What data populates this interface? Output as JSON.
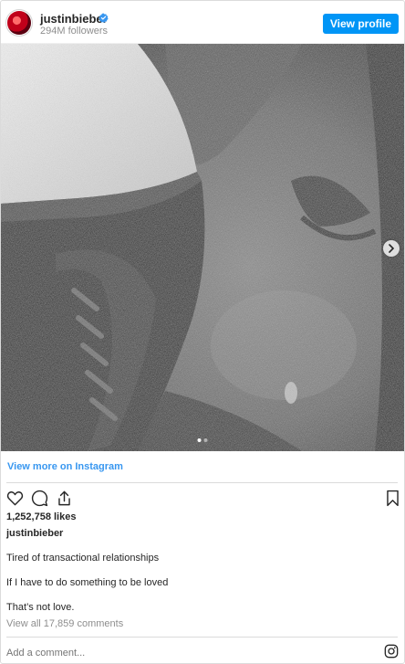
{
  "post": {
    "username": "justinbieber",
    "followers": "294M followers",
    "view_profile_label": "View profile",
    "view_more_label": "View more on Instagram",
    "likes": "1,252,758 likes",
    "caption_username": "justinbieber",
    "caption_lines": [
      "Tired of transactional relationships",
      "If I have to do something to be loved",
      "That’s not love."
    ],
    "comments_label": "View all 17,859 comments",
    "add_comment_placeholder": "Add a comment...",
    "carousel": {
      "slide_count": 2,
      "active_slide": 1
    }
  },
  "colors": {
    "accent": "#0095f6",
    "link": "#3897f0",
    "text": "#262626",
    "muted": "#8e8e8e",
    "border": "#dbdbdb"
  },
  "icons": [
    "verified-badge-icon",
    "heart-icon",
    "comment-icon",
    "share-icon",
    "bookmark-icon",
    "chevron-right-icon",
    "instagram-icon"
  ]
}
